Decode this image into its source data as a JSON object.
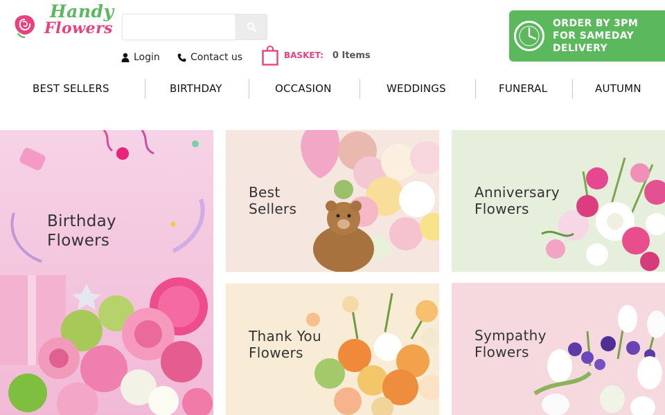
{
  "header": {
    "logo": {
      "line1": "Handy",
      "line2": "Flowers"
    },
    "search": {
      "placeholder": "",
      "value": "",
      "button_icon": "search-icon"
    },
    "login_label": "Login",
    "contact_label": "Contact us",
    "basket": {
      "label": "BASKET:",
      "count": "0 Items"
    },
    "order_banner": {
      "line1": "ORDER BY 3PM",
      "line2": "FOR SAMEDAY",
      "line3": "DELIVERY"
    }
  },
  "nav": {
    "items": [
      "BEST SELLERS",
      "BIRTHDAY",
      "OCCASION",
      "WEDDINGS",
      "FUNERAL",
      "AUTUMN"
    ]
  },
  "tiles": [
    {
      "id": "birthday",
      "line1": "Birthday",
      "line2": "Flowers",
      "bg": "#f6cfe3"
    },
    {
      "id": "best-sellers",
      "line1": "Best",
      "line2": "Sellers",
      "bg": "#f5e6df"
    },
    {
      "id": "anniversary",
      "line1": "Anniversary",
      "line2": "Flowers",
      "bg": "#e6eedc"
    },
    {
      "id": "thank-you",
      "line1": "Thank You",
      "line2": "Flowers",
      "bg": "#f8ecd6"
    },
    {
      "id": "sympathy",
      "line1": "Sympathy",
      "line2": "Flowers",
      "bg": "#f5d9df"
    }
  ],
  "colors": {
    "brand_pink": "#e8417c",
    "brand_green": "#5cb85c",
    "search_button": "#ececec"
  }
}
